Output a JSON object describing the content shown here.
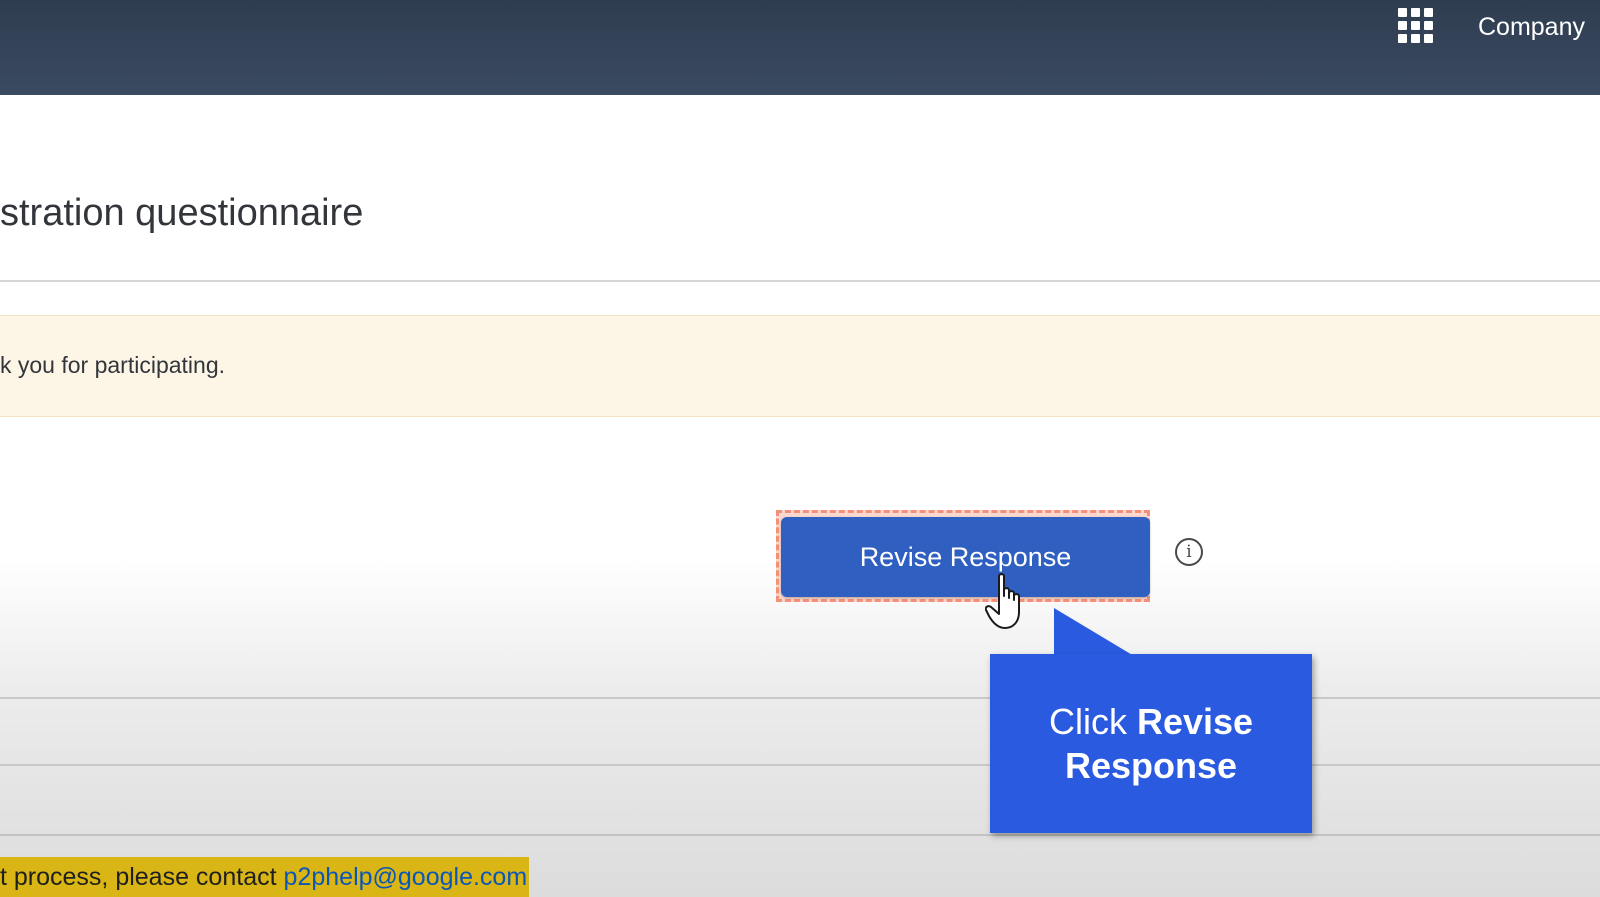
{
  "header": {
    "apps_icon": "grid-apps-icon",
    "company_label": "Company"
  },
  "page": {
    "title": "stration questionnaire"
  },
  "notice": {
    "text": "k you for participating."
  },
  "actions": {
    "revise_button_label": "Revise Response",
    "info_icon": "info-icon",
    "info_glyph": "i"
  },
  "callout": {
    "prefix": "Click ",
    "bold_line_1": "Revise",
    "bold_line_2": "Response"
  },
  "footer": {
    "text": "t process, please contact",
    "email": "p2phelp@google.com"
  },
  "colors": {
    "header_bg": "#34445a",
    "primary_button": "#2e5fc1",
    "callout_bg": "#2a5ae0",
    "notice_bg": "#fdf6e7",
    "highlight_dash": "#f2907a",
    "footer_highlight": "#d9b515",
    "link": "#0a57b8"
  }
}
